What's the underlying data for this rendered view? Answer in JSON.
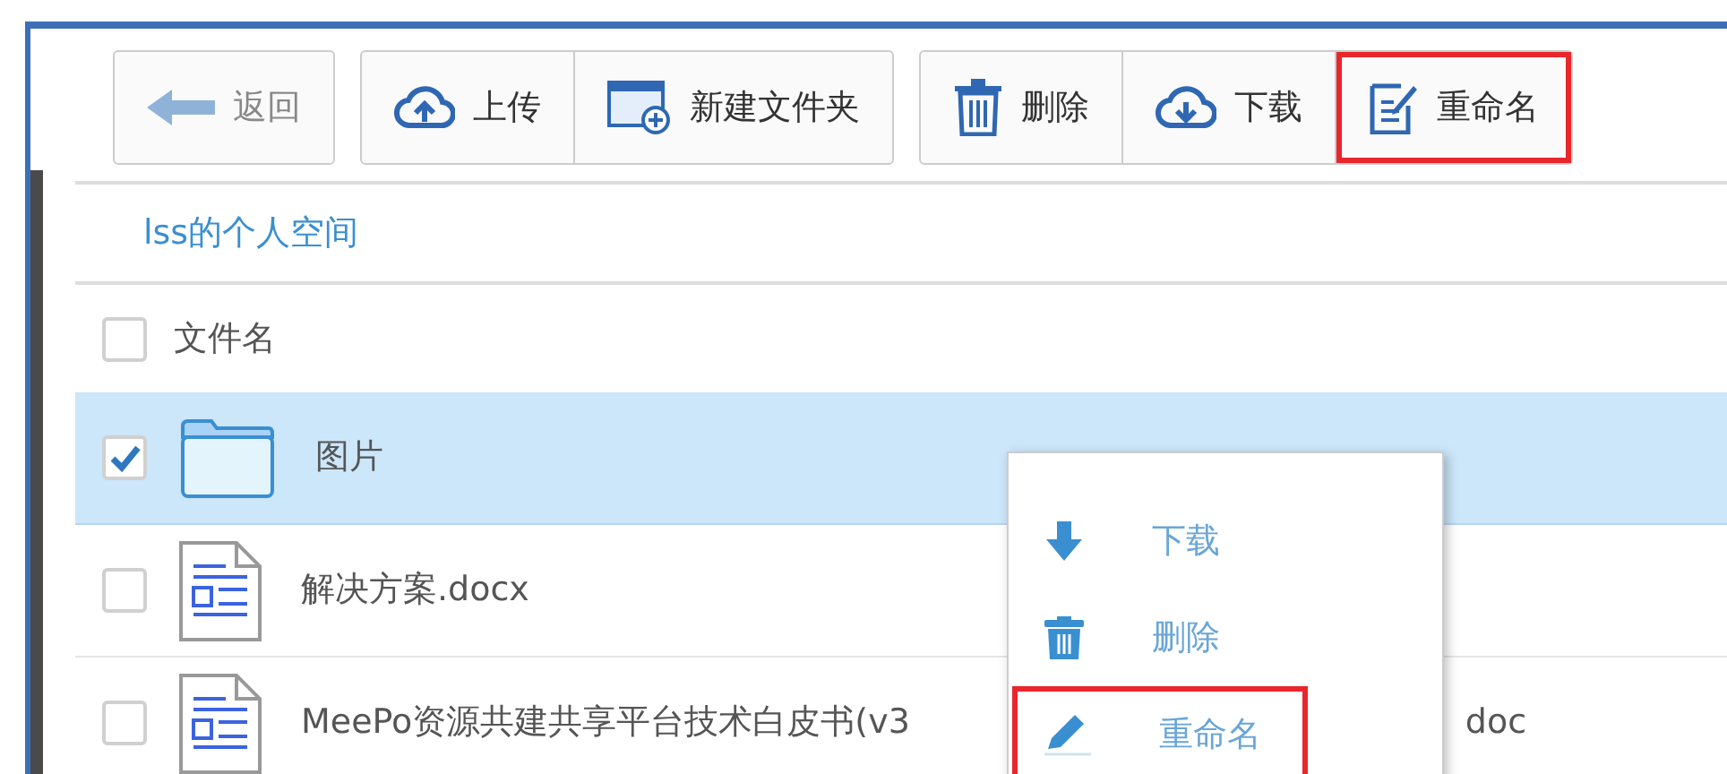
{
  "toolbar": {
    "groups": [
      {
        "buttons": [
          {
            "label": "返回",
            "kind": "back",
            "disabled": true,
            "highlighted": false
          }
        ]
      },
      {
        "buttons": [
          {
            "label": "上传",
            "kind": "upload",
            "disabled": false,
            "highlighted": false
          },
          {
            "label": "新建文件夹",
            "kind": "new-folder",
            "disabled": false,
            "highlighted": false
          }
        ]
      },
      {
        "buttons": [
          {
            "label": "删除",
            "kind": "delete",
            "disabled": false,
            "highlighted": false
          },
          {
            "label": "下载",
            "kind": "download",
            "disabled": false,
            "highlighted": false
          },
          {
            "label": "重命名",
            "kind": "rename",
            "disabled": false,
            "highlighted": true
          }
        ]
      }
    ]
  },
  "breadcrumb": "lss的个人空间",
  "table": {
    "header": {
      "label": "文件名",
      "checked": false
    },
    "rows": [
      {
        "kind": "folder",
        "name": "图片",
        "checked": true,
        "selected": true
      },
      {
        "kind": "document",
        "name": "解决方案.docx",
        "checked": false,
        "selected": false
      },
      {
        "kind": "document",
        "name": "MeePo资源共建共享平台技术白皮书(v3",
        "name_end": "doc",
        "checked": false,
        "selected": false
      }
    ]
  },
  "context_menu": {
    "items": [
      {
        "label": "下载",
        "kind": "download",
        "highlighted": false
      },
      {
        "label": "删除",
        "kind": "delete",
        "highlighted": false
      },
      {
        "label": "重命名",
        "kind": "rename",
        "highlighted": true
      }
    ]
  }
}
